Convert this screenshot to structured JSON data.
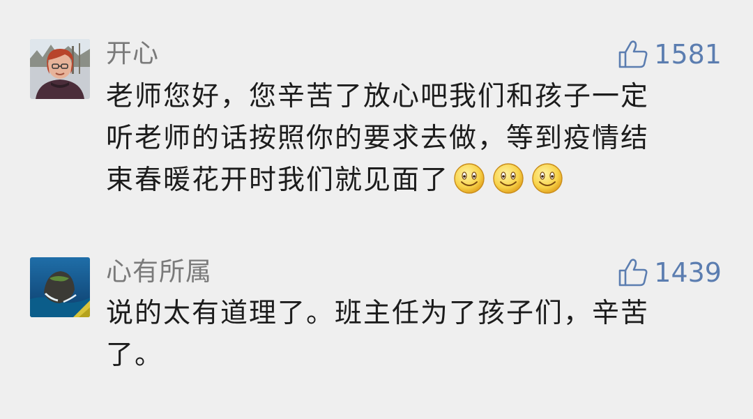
{
  "comments": [
    {
      "username": "开心",
      "likes": "1581",
      "text_lines": [
        "老师您好，您辛苦了放心吧我们和孩子一定",
        "听老师的话按照你的要求去做，等到疫情结",
        "束春暖花开时我们就见面了"
      ],
      "emoji": [
        "smile-emoji",
        "smile-emoji",
        "smile-emoji"
      ]
    },
    {
      "username": "心有所属",
      "likes": "1439",
      "text_lines": [
        "说的太有道理了。班主任为了孩子们，辛苦",
        "了。"
      ]
    }
  ],
  "icons": {
    "like": "thumbs-up-icon",
    "emoji": "smile-emoji"
  },
  "colors": {
    "background": "#efefef",
    "username": "#7a7a7a",
    "like": "#5b7db0",
    "text": "#1c1c1c"
  }
}
